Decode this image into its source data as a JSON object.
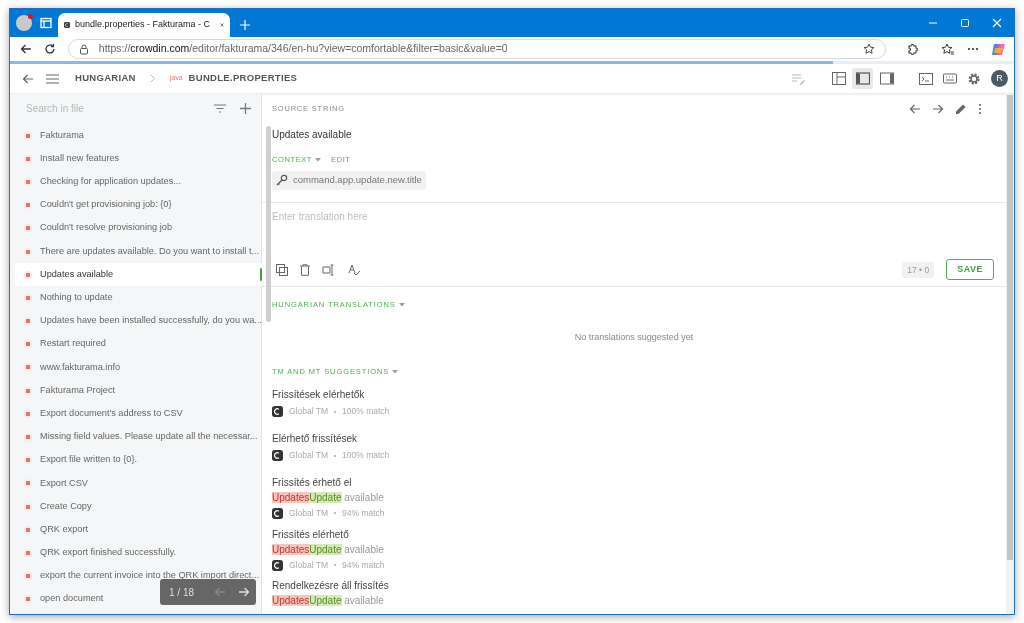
{
  "browser": {
    "tab_title": "bundle.properties - Fakturama - C",
    "url_host": "crowdin.com",
    "url_scheme": "https://",
    "url_path": "/editor/fakturama/346/en-hu?view=comfortable&filter=basic&value=0",
    "load_bar": {
      "level": 0.82
    }
  },
  "header": {
    "breadcrumb": [
      {
        "label": "HUNGARIAN",
        "kind": "language"
      },
      {
        "label": "BUNDLE.PROPERTIES",
        "kind": "file",
        "badge": "java"
      }
    ],
    "view_modes": [
      {
        "selected": false
      },
      {
        "selected": true
      },
      {
        "selected": false
      }
    ],
    "avatar": "R"
  },
  "sidebar": {
    "search_placeholder": "Search in file",
    "items": [
      {
        "text": "Fakturama",
        "selected": false
      },
      {
        "text": "Install new features",
        "selected": false
      },
      {
        "text": "Checking for application updates...",
        "selected": false
      },
      {
        "text": "Couldn't get provisioning job: {0}",
        "selected": false
      },
      {
        "text": "Couldn't resolve provisioning job",
        "selected": false
      },
      {
        "text": "There are updates available. Do you want to install t...",
        "selected": false
      },
      {
        "text": "Updates available",
        "selected": true
      },
      {
        "text": "Nothing to update",
        "selected": false
      },
      {
        "text": "Updates have been installed successfully, do you wa...",
        "selected": false
      },
      {
        "text": "Restart required",
        "selected": false
      },
      {
        "text": "www.fakturama.info",
        "selected": false
      },
      {
        "text": "Fakturama Project",
        "selected": false
      },
      {
        "text": "Export document's address to CSV",
        "selected": false
      },
      {
        "text": "Missing field values. Please update all the necessar...",
        "selected": false
      },
      {
        "text": "Export file written to {0}.",
        "selected": false
      },
      {
        "text": "Export CSV",
        "selected": false
      },
      {
        "text": "Create Copy",
        "selected": false
      },
      {
        "text": "QRK export",
        "selected": false
      },
      {
        "text": "QRK export finished successfully.",
        "selected": false
      },
      {
        "text": "export the current invoice into the QRK import direct...",
        "selected": false
      },
      {
        "text": "open document",
        "selected": false
      }
    ],
    "pager": {
      "text": "1 / 18",
      "prev_disabled": true,
      "next_disabled": false
    }
  },
  "source": {
    "heading": "SOURCE STRING",
    "text": "Updates available",
    "context_label": "CONTEXT",
    "edit_label": "EDIT",
    "key": "command.app.update.new.title"
  },
  "editor": {
    "placeholder": "Enter translation here",
    "counter": "17 • 0",
    "save": "SAVE"
  },
  "translations": {
    "heading": "HUNGARIAN TRANSLATIONS",
    "empty": "No translations suggested yet"
  },
  "suggestions": {
    "heading": "TM AND MT SUGGESTIONS",
    "items": [
      {
        "text": "Frissítések elérhetők",
        "source": "Global TM",
        "match": "100% match"
      },
      {
        "text": "Elérhető frissítések",
        "source": "Global TM",
        "match": "100% match"
      },
      {
        "text": "Frissítés érhető el",
        "diff": [
          {
            "kind": "removed",
            "text": "Updates"
          },
          {
            "kind": "added",
            "text": "Update"
          },
          {
            "kind": "same",
            "text": " available"
          }
        ],
        "source": "Global TM",
        "match": "94% match"
      },
      {
        "text": "Frissítés elérhető",
        "diff": [
          {
            "kind": "removed",
            "text": "Updates"
          },
          {
            "kind": "added",
            "text": "Update"
          },
          {
            "kind": "same",
            "text": " available"
          }
        ],
        "source": "Global TM",
        "match": "94% match"
      },
      {
        "text": "Rendelkezésre áll frissítés",
        "diff": [
          {
            "kind": "removed",
            "text": "Updates"
          },
          {
            "kind": "added",
            "text": "Update"
          },
          {
            "kind": "same",
            "text": " available"
          }
        ]
      }
    ]
  }
}
